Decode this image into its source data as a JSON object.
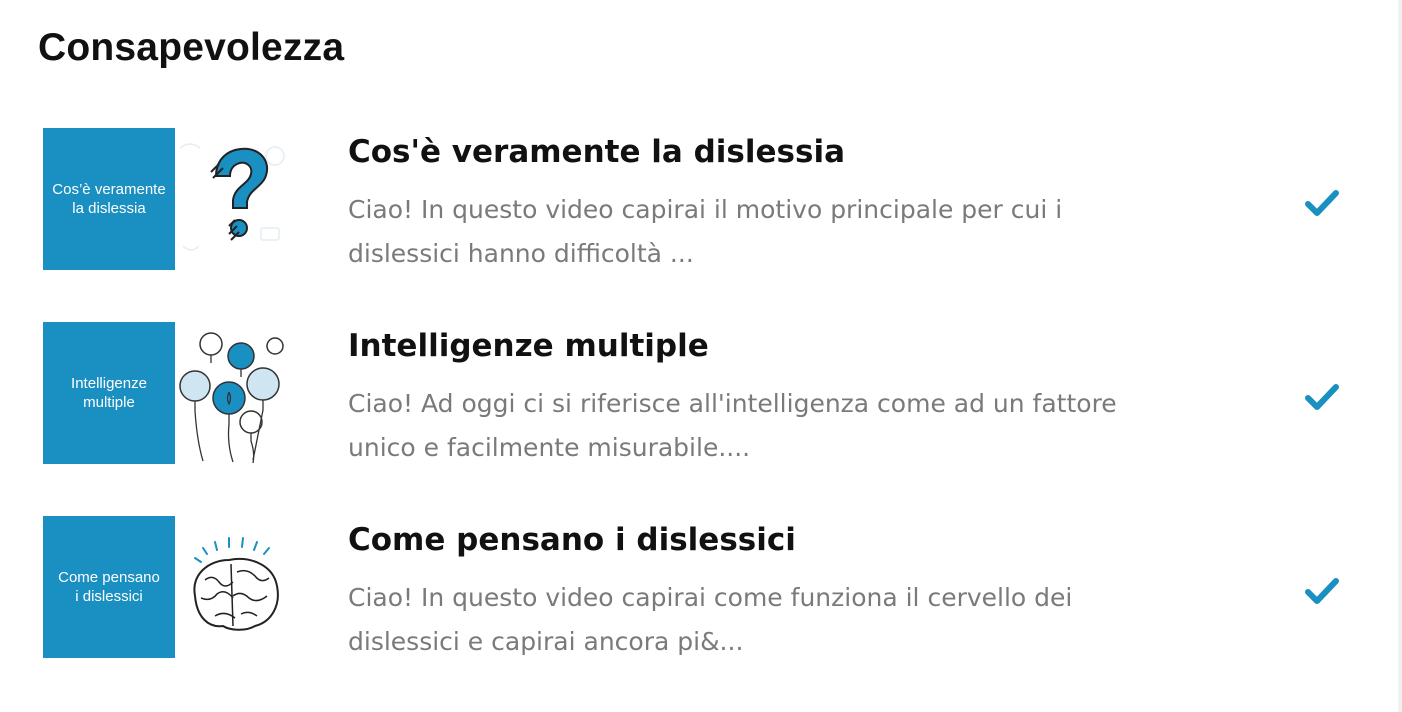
{
  "section": {
    "title": "Consapevolezza"
  },
  "accent_color": "#1a8fc1",
  "lessons": [
    {
      "thumb_text": "Cos’è veramente\nla dislessia",
      "thumb_icon": "question-mark-icon",
      "title": "Cos'è veramente la dislessia",
      "description": "Ciao! In questo video capirai il motivo principale per cui i dislessici hanno difficoltà ...",
      "completed": true,
      "status_icon": "check-icon"
    },
    {
      "thumb_text": "Intelligenze\nmultiple",
      "thumb_icon": "light-bulbs-icon",
      "title": "Intelligenze multiple",
      "description": "Ciao! Ad oggi ci si riferisce all'intelligenza come ad un fattore unico e facilmente misurabile....",
      "completed": true,
      "status_icon": "check-icon"
    },
    {
      "thumb_text": "Come pensano\ni dislessici",
      "thumb_icon": "brain-icon",
      "title": "Come pensano i dislessici",
      "description": "Ciao! In questo video capirai come funziona il cervello dei dislessici e capirai ancora pi&...",
      "completed": true,
      "status_icon": "check-icon"
    }
  ]
}
